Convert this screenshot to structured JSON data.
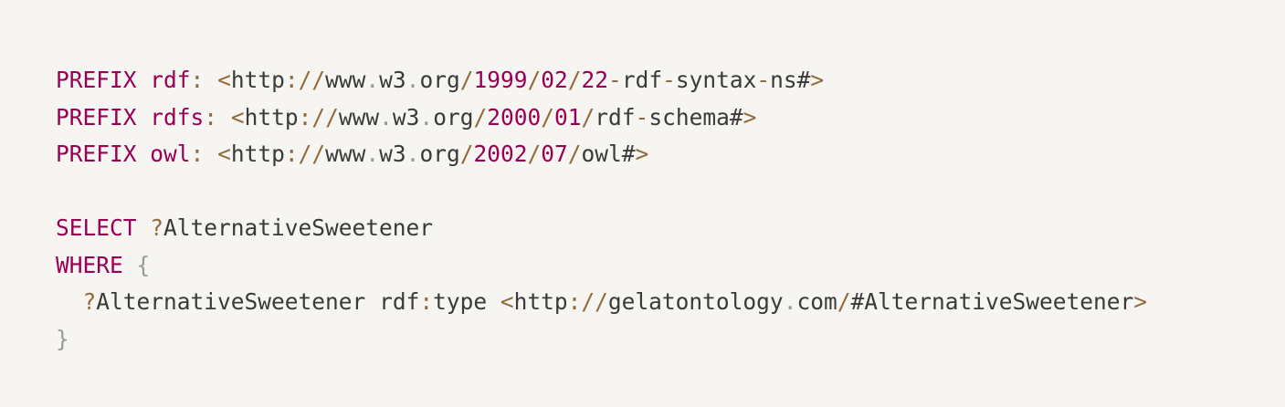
{
  "colors": {
    "background": "#f7f5f2",
    "keyword": "#990055",
    "punctuation": "#906a3a",
    "text": "#3a3a3a",
    "muted": "#999999"
  },
  "code": {
    "language": "SPARQL",
    "lines": [
      [
        {
          "t": "PREFIX",
          "c": "kw"
        },
        {
          "t": " ",
          "c": "va"
        },
        {
          "t": "rdf",
          "c": "kw"
        },
        {
          "t": ":",
          "c": "pn"
        },
        {
          "t": " ",
          "c": "va"
        },
        {
          "t": "<",
          "c": "pn"
        },
        {
          "t": "http",
          "c": "va"
        },
        {
          "t": "://",
          "c": "pn"
        },
        {
          "t": "www",
          "c": "va"
        },
        {
          "t": ".",
          "c": "dt"
        },
        {
          "t": "w3",
          "c": "va"
        },
        {
          "t": ".",
          "c": "dt"
        },
        {
          "t": "org",
          "c": "va"
        },
        {
          "t": "/",
          "c": "pn"
        },
        {
          "t": "1999",
          "c": "nu"
        },
        {
          "t": "/",
          "c": "pn"
        },
        {
          "t": "02",
          "c": "nu"
        },
        {
          "t": "/",
          "c": "pn"
        },
        {
          "t": "22",
          "c": "nu"
        },
        {
          "t": "-",
          "c": "pn"
        },
        {
          "t": "rdf",
          "c": "va"
        },
        {
          "t": "-",
          "c": "pn"
        },
        {
          "t": "syntax",
          "c": "va"
        },
        {
          "t": "-",
          "c": "pn"
        },
        {
          "t": "ns#",
          "c": "va"
        },
        {
          "t": ">",
          "c": "pn"
        }
      ],
      [
        {
          "t": "PREFIX",
          "c": "kw"
        },
        {
          "t": " ",
          "c": "va"
        },
        {
          "t": "rdfs",
          "c": "kw"
        },
        {
          "t": ":",
          "c": "pn"
        },
        {
          "t": " ",
          "c": "va"
        },
        {
          "t": "<",
          "c": "pn"
        },
        {
          "t": "http",
          "c": "va"
        },
        {
          "t": "://",
          "c": "pn"
        },
        {
          "t": "www",
          "c": "va"
        },
        {
          "t": ".",
          "c": "dt"
        },
        {
          "t": "w3",
          "c": "va"
        },
        {
          "t": ".",
          "c": "dt"
        },
        {
          "t": "org",
          "c": "va"
        },
        {
          "t": "/",
          "c": "pn"
        },
        {
          "t": "2000",
          "c": "nu"
        },
        {
          "t": "/",
          "c": "pn"
        },
        {
          "t": "01",
          "c": "nu"
        },
        {
          "t": "/",
          "c": "pn"
        },
        {
          "t": "rdf",
          "c": "va"
        },
        {
          "t": "-",
          "c": "pn"
        },
        {
          "t": "schema#",
          "c": "va"
        },
        {
          "t": ">",
          "c": "pn"
        }
      ],
      [
        {
          "t": "PREFIX",
          "c": "kw"
        },
        {
          "t": " ",
          "c": "va"
        },
        {
          "t": "owl",
          "c": "kw"
        },
        {
          "t": ":",
          "c": "pn"
        },
        {
          "t": " ",
          "c": "va"
        },
        {
          "t": "<",
          "c": "pn"
        },
        {
          "t": "http",
          "c": "va"
        },
        {
          "t": "://",
          "c": "pn"
        },
        {
          "t": "www",
          "c": "va"
        },
        {
          "t": ".",
          "c": "dt"
        },
        {
          "t": "w3",
          "c": "va"
        },
        {
          "t": ".",
          "c": "dt"
        },
        {
          "t": "org",
          "c": "va"
        },
        {
          "t": "/",
          "c": "pn"
        },
        {
          "t": "2002",
          "c": "nu"
        },
        {
          "t": "/",
          "c": "pn"
        },
        {
          "t": "07",
          "c": "nu"
        },
        {
          "t": "/",
          "c": "pn"
        },
        {
          "t": "owl#",
          "c": "va"
        },
        {
          "t": ">",
          "c": "pn"
        }
      ],
      [],
      [
        {
          "t": "SELECT",
          "c": "kw"
        },
        {
          "t": " ",
          "c": "va"
        },
        {
          "t": "?",
          "c": "pn"
        },
        {
          "t": "AlternativeSweetener",
          "c": "va"
        }
      ],
      [
        {
          "t": "WHERE",
          "c": "kw"
        },
        {
          "t": " ",
          "c": "va"
        },
        {
          "t": "{",
          "c": "br"
        }
      ],
      [
        {
          "t": "  ",
          "c": "va"
        },
        {
          "t": "?",
          "c": "pn"
        },
        {
          "t": "AlternativeSweetener",
          "c": "va"
        },
        {
          "t": " ",
          "c": "va"
        },
        {
          "t": "rdf",
          "c": "va"
        },
        {
          "t": ":",
          "c": "pn"
        },
        {
          "t": "type",
          "c": "va"
        },
        {
          "t": " ",
          "c": "va"
        },
        {
          "t": "<",
          "c": "pn"
        },
        {
          "t": "http",
          "c": "va"
        },
        {
          "t": "://",
          "c": "pn"
        },
        {
          "t": "gelatontology",
          "c": "va"
        },
        {
          "t": ".",
          "c": "dt"
        },
        {
          "t": "com",
          "c": "va"
        },
        {
          "t": "/",
          "c": "pn"
        },
        {
          "t": "#AlternativeSweetener",
          "c": "va"
        },
        {
          "t": ">",
          "c": "pn"
        }
      ],
      [
        {
          "t": "}",
          "c": "br"
        }
      ]
    ]
  }
}
